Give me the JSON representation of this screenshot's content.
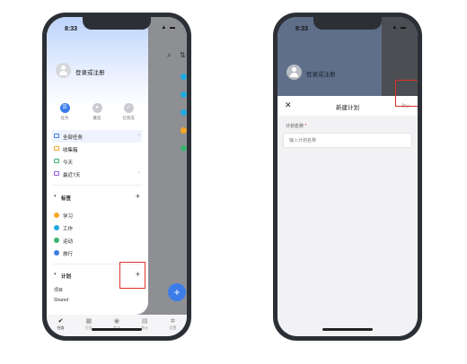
{
  "left": {
    "status_time": "8:33",
    "login_text": "登录或注册",
    "quick_actions": [
      {
        "label": "任务",
        "icon": "list-icon"
      },
      {
        "label": "番茄",
        "icon": "tomato-icon"
      },
      {
        "label": "已完成",
        "icon": "check-icon"
      }
    ],
    "nav_items": [
      {
        "label": "全部任务",
        "icon": "inbox-icon",
        "tail": "›"
      },
      {
        "label": "收集箱",
        "icon": "tray-icon",
        "tail": ""
      },
      {
        "label": "今天",
        "icon": "today-icon",
        "tail": ""
      },
      {
        "label": "最近7天",
        "icon": "week-icon",
        "tail": "›"
      }
    ],
    "tags_section": "标签",
    "tags": [
      {
        "label": "学习",
        "color": "#f5a623"
      },
      {
        "label": "工作",
        "color": "#1fa9e1"
      },
      {
        "label": "运动",
        "color": "#3cb371"
      },
      {
        "label": "旅行",
        "color": "#3b7ce8"
      }
    ],
    "plans_section": "计划",
    "plan_rows": [
      "项目",
      "Shared"
    ],
    "tabbar": [
      {
        "label": "任务",
        "icon": "check-icon"
      },
      {
        "label": "日历",
        "icon": "calendar-icon"
      },
      {
        "label": "专注",
        "icon": "timer-icon"
      },
      {
        "label": "统计",
        "icon": "stats-icon"
      },
      {
        "label": "设置",
        "icon": "gear-icon"
      }
    ],
    "fab_label": "+",
    "bg_dot_colors": [
      "#1fa9e1",
      "#1fa9e1",
      "#1fa9e1",
      "#f5a623",
      "#3cb371"
    ]
  },
  "right": {
    "status_time": "8:33",
    "login_text": "登录或注册",
    "close_icon": "✕",
    "title": "新建计划",
    "confirm_label": "确认",
    "field_label": "计划名称",
    "required_mark": "*",
    "field_placeholder": "输入计划名称"
  },
  "colors": {
    "accent": "#3b7ce8",
    "highlight_box": "#e0312a"
  }
}
